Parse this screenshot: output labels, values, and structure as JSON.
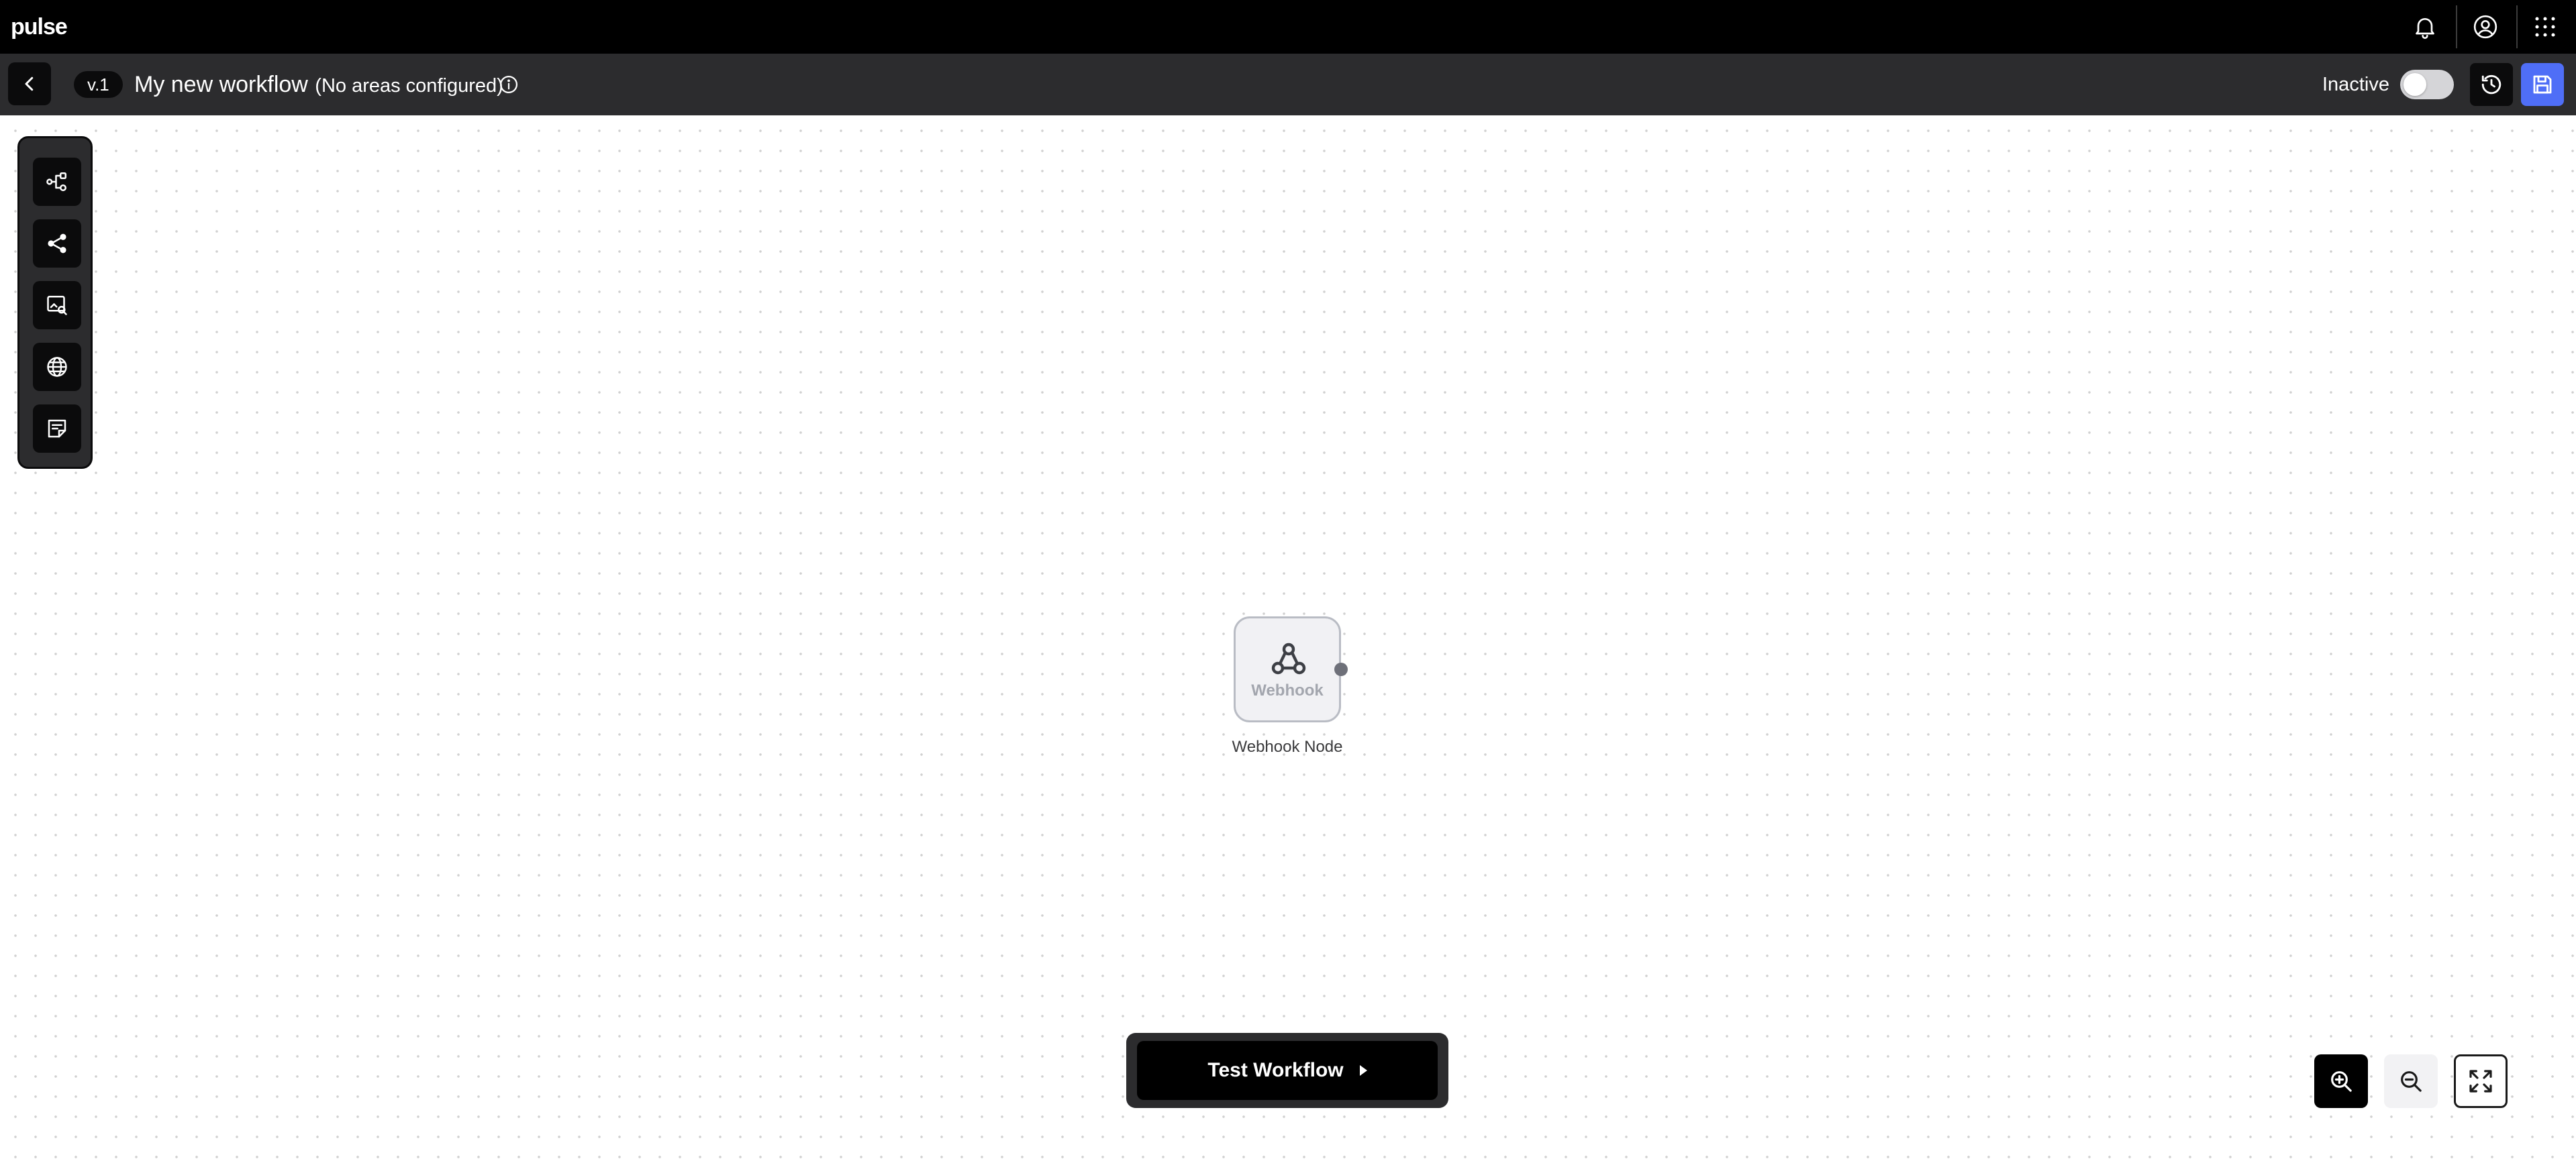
{
  "app": {
    "logo": "pulse"
  },
  "topbar": {
    "icons": [
      "bell-icon",
      "user-circle-icon",
      "apps-grid-icon"
    ]
  },
  "header": {
    "version": "v.1",
    "workflow_name": "My new workflow",
    "workflow_note": "(No areas configured)",
    "status_label": "Inactive",
    "active": false
  },
  "palette": {
    "tools": [
      "flow-nodes-icon",
      "share-branch-icon",
      "image-search-icon",
      "globe-icon",
      "sticky-note-icon"
    ]
  },
  "canvas": {
    "node": {
      "label": "Webhook",
      "caption": "Webhook Node",
      "icon": "webhook-icon"
    }
  },
  "actions": {
    "test_label": "Test Workflow"
  },
  "zoom": {
    "icons": [
      "zoom-in-icon",
      "zoom-out-icon",
      "fit-view-icon"
    ]
  },
  "colors": {
    "topbar": "#000000",
    "subbar": "#2c2c2e",
    "accent": "#4f6ef7",
    "node_border": "#b9bcc4"
  }
}
